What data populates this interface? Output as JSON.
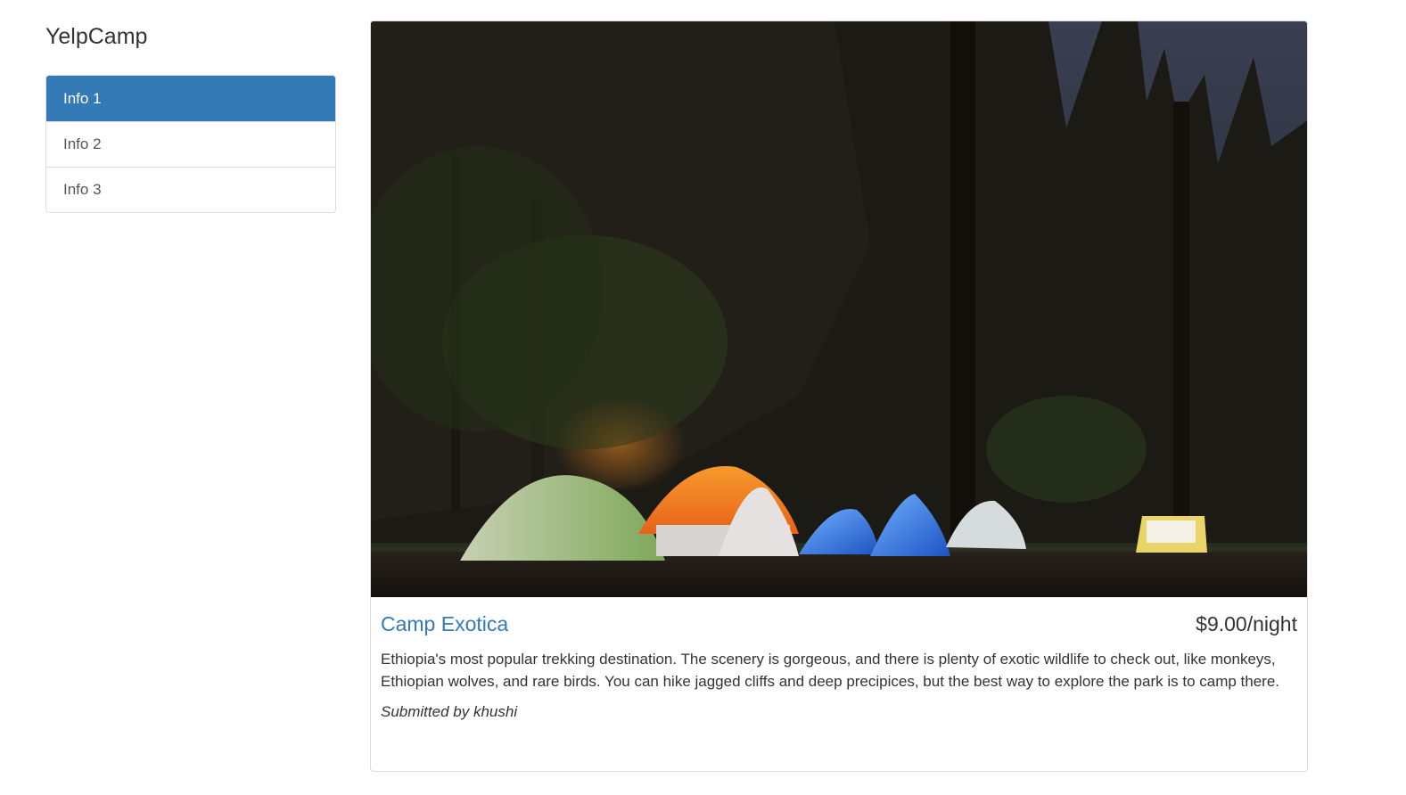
{
  "brand": "YelpCamp",
  "sidebar": {
    "items": [
      {
        "label": "Info 1",
        "active": true
      },
      {
        "label": "Info 2",
        "active": false
      },
      {
        "label": "Info 3",
        "active": false
      }
    ]
  },
  "campground": {
    "name": "Camp Exotica",
    "price": "$9.00/night",
    "description": "Ethiopia's most popular trekking destination. The scenery is gorgeous, and there is plenty of exotic wildlife to check out, like monkeys, Ethiopian wolves, and rare birds. You can hike jagged cliffs and deep precipices, but the best way to explore the park is to camp there.",
    "submitted_prefix": "Submitted by",
    "author": "khushi"
  },
  "colors": {
    "accent": "#337ab7",
    "border": "#dddddd",
    "text": "#333333"
  }
}
